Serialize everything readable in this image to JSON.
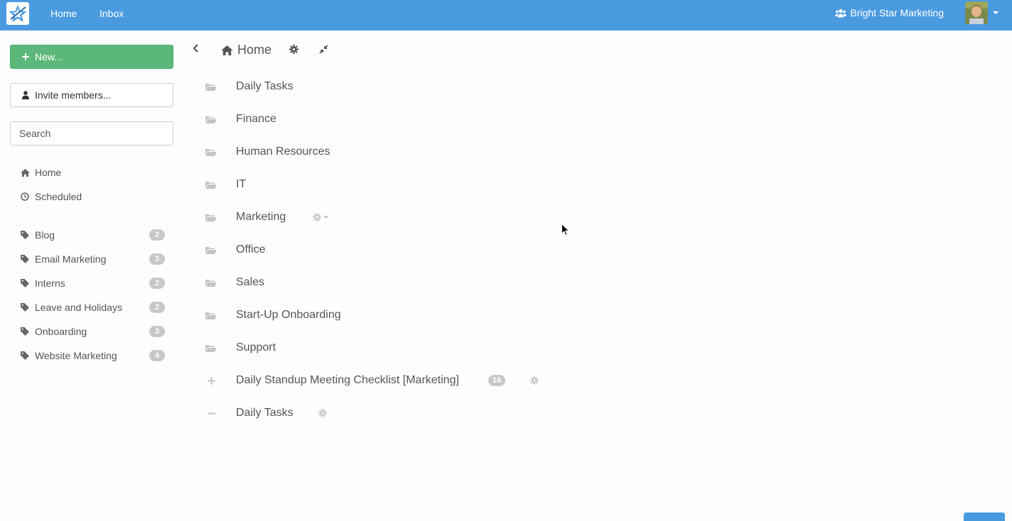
{
  "topbar": {
    "nav": [
      "Home",
      "Inbox"
    ],
    "org_name": "Bright Star Marketing"
  },
  "sidebar": {
    "new_label": "New...",
    "invite_label": "Invite members...",
    "search_placeholder": "Search",
    "nav": [
      {
        "label": "Home",
        "icon": "home-icon"
      },
      {
        "label": "Scheduled",
        "icon": "clock-icon"
      }
    ],
    "tags": [
      {
        "label": "Blog",
        "count": "2"
      },
      {
        "label": "Email Marketing",
        "count": "3"
      },
      {
        "label": "Interns",
        "count": "2"
      },
      {
        "label": "Leave and Holidays",
        "count": "2"
      },
      {
        "label": "Onboarding",
        "count": "3"
      },
      {
        "label": "Website Marketing",
        "count": "4"
      }
    ]
  },
  "main": {
    "breadcrumb": "Home",
    "items": [
      {
        "label": "Daily Tasks",
        "icon": "folder-open-icon"
      },
      {
        "label": "Finance",
        "icon": "folder-open-icon"
      },
      {
        "label": "Human Resources",
        "icon": "folder-open-icon"
      },
      {
        "label": "IT",
        "icon": "folder-open-icon"
      },
      {
        "label": "Marketing",
        "icon": "folder-open-icon"
      },
      {
        "label": "Office",
        "icon": "folder-open-icon"
      },
      {
        "label": "Sales",
        "icon": "folder-open-icon"
      },
      {
        "label": "Start-Up Onboarding",
        "icon": "folder-open-icon"
      },
      {
        "label": "Support",
        "icon": "folder-open-icon"
      },
      {
        "label": "Daily Standup Meeting Checklist [Marketing]",
        "icon": "plus-icon",
        "count": "16"
      },
      {
        "label": "Daily Tasks",
        "icon": "minus-icon"
      }
    ]
  },
  "colors": {
    "topbar": "#4a9ae0",
    "new_button": "#5cb87a",
    "badge": "#c8c8c8",
    "text": "#555555"
  }
}
